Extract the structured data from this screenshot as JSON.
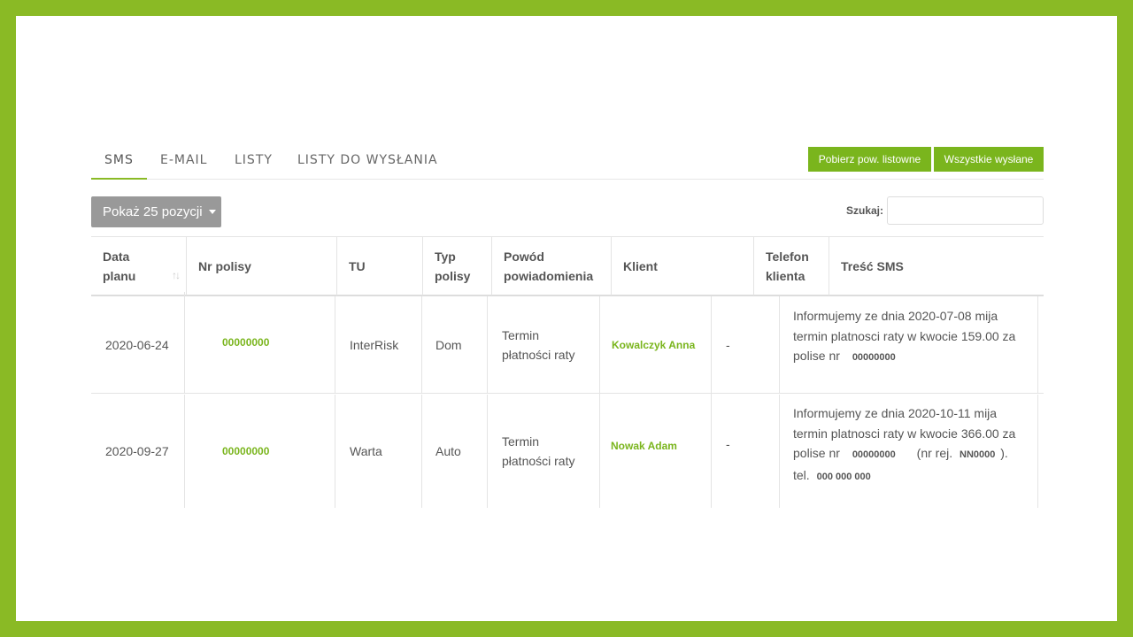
{
  "tabs": [
    {
      "label": "SMS"
    },
    {
      "label": "E-MAIL"
    },
    {
      "label": "LISTY"
    },
    {
      "label": "LISTY DO WYSŁANIA"
    }
  ],
  "buttons": {
    "download_letters": "Pobierz pow. listowne",
    "all_sent": "Wszystkie wysłane"
  },
  "pagesize": {
    "label": "Pokaż 25 pozycji"
  },
  "search": {
    "label": "Szukaj:",
    "value": ""
  },
  "columns": {
    "date_l1": "Data",
    "date_l2": "planu",
    "policy": "Nr polisy",
    "tu": "TU",
    "type_l1": "Typ",
    "type_l2": "polisy",
    "reason_l1": "Powód",
    "reason_l2": "powiadomienia",
    "client": "Klient",
    "phone_l1": "Telefon",
    "phone_l2": "klienta",
    "sms": "Treść SMS"
  },
  "rows": [
    {
      "date": "2020-06-24",
      "policy": "00000000",
      "tu": "InterRisk",
      "type": "Dom",
      "reason_l1": "Termin",
      "reason_l2": "płatności raty",
      "client": "Kowalczyk Anna",
      "phone": "-",
      "sms_l1": "Informujemy ze dnia 2020-07-08 mija",
      "sms_l2": "termin platnosci raty w kwocie 159.00 za",
      "sms_l3a": "polise nr",
      "sms_l3b": "00000000"
    },
    {
      "date": "2020-09-27",
      "policy": "00000000",
      "tu": "Warta",
      "type": "Auto",
      "reason_l1": "Termin",
      "reason_l2": "płatności raty",
      "client": "Nowak Adam",
      "phone": "-",
      "sms_l1": "Informujemy ze dnia 2020-10-11 mija",
      "sms_l2": "termin platnosci raty w kwocie 366.00 za",
      "sms_l3a": "polise nr",
      "sms_l3b": "00000000",
      "sms_l3c": "(nr rej.",
      "sms_l3d": "NN0000",
      "sms_l3e": ").",
      "sms_l4a": "tel.",
      "sms_l4b": "000 000 000"
    }
  ]
}
